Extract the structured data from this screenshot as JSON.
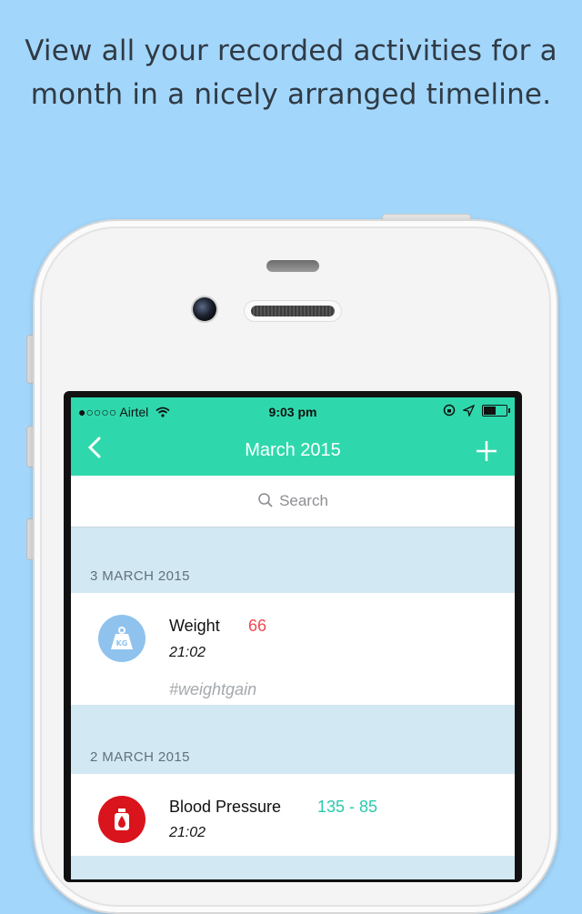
{
  "headline": {
    "line1": "View all your recorded activities for a",
    "line2": "month  in a nicely arranged timeline."
  },
  "status_bar": {
    "carrier": "●○○○○ Airtel",
    "time": "9:03 pm"
  },
  "nav": {
    "title": "March 2015",
    "back_icon": "chevron-left-icon",
    "add_icon": "plus-icon"
  },
  "search": {
    "placeholder": "Search"
  },
  "sections": [
    {
      "date": "3 MARCH 2015",
      "entries": [
        {
          "name": "Weight",
          "value": "66",
          "time": "21:02",
          "tag": "#weightgain",
          "icon": "weight-kg-icon",
          "icon_color": "#8fc3ee",
          "value_color": "#f04a55"
        }
      ]
    },
    {
      "date": "2 MARCH 2015",
      "entries": [
        {
          "name": "Blood Pressure",
          "value": "135 - 85",
          "time": "21:02",
          "icon": "blood-drop-icon",
          "icon_color": "#d9141c",
          "value_color": "#2bc9ad"
        }
      ]
    }
  ],
  "colors": {
    "background": "#a3d6fb",
    "accent": "#2fd8ac"
  }
}
